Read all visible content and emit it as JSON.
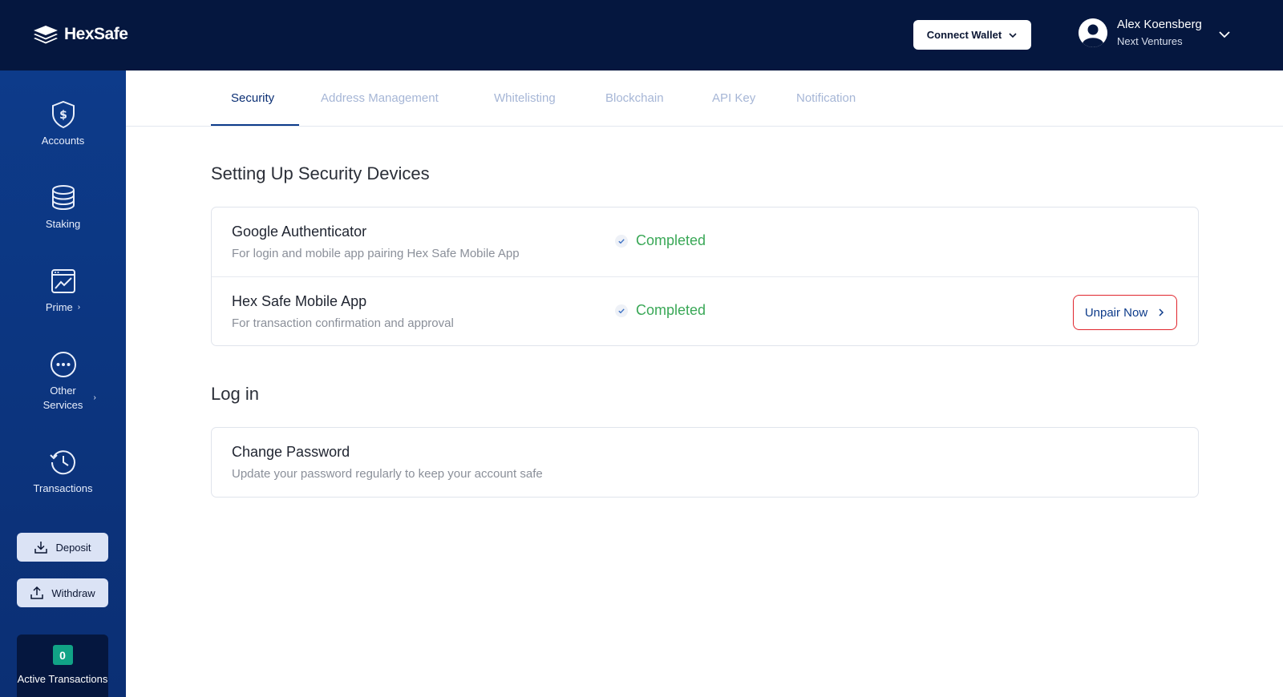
{
  "brand": {
    "name": "HexSafe"
  },
  "header": {
    "connect_wallet_label": "Connect Wallet",
    "user_name": "Alex Koensberg",
    "user_org": "Next Ventures"
  },
  "sidebar": {
    "items": [
      {
        "label": "Accounts",
        "icon": "shield-dollar-icon"
      },
      {
        "label": "Staking",
        "icon": "database-stack-icon"
      },
      {
        "label": "Prime",
        "icon": "chart-window-icon"
      },
      {
        "label": "Other Services",
        "icon": "more-dots-icon"
      },
      {
        "label": "Transactions",
        "icon": "history-clock-icon"
      }
    ],
    "deposit_label": "Deposit",
    "withdraw_label": "Withdraw",
    "active_transactions_count": "0",
    "active_transactions_label": "Active Transactions"
  },
  "tabs": [
    {
      "label": "Security",
      "active": true
    },
    {
      "label": "Address Management",
      "active": false
    },
    {
      "label": "Whitelisting",
      "active": false
    },
    {
      "label": "Blockchain",
      "active": false
    },
    {
      "label": "API Key",
      "active": false
    },
    {
      "label": "Notification",
      "active": false
    }
  ],
  "security_devices": {
    "title": "Setting Up Security Devices",
    "rows": [
      {
        "title": "Google Authenticator",
        "description": "For login and mobile app pairing Hex Safe Mobile App",
        "status": "Completed"
      },
      {
        "title": "Hex Safe Mobile App",
        "description": "For transaction confirmation and approval",
        "status": "Completed",
        "action_label": "Unpair Now"
      }
    ]
  },
  "login": {
    "title": "Log in",
    "rows": [
      {
        "title": "Change Password",
        "description": "Update your password regularly to keep your account safe"
      }
    ]
  },
  "colors": {
    "header_bg": "#05173f",
    "sidebar_bg": "#0d3b8a",
    "status_green": "#3aa857",
    "unpair_border": "#e0252d",
    "badge_teal": "#11a386"
  }
}
